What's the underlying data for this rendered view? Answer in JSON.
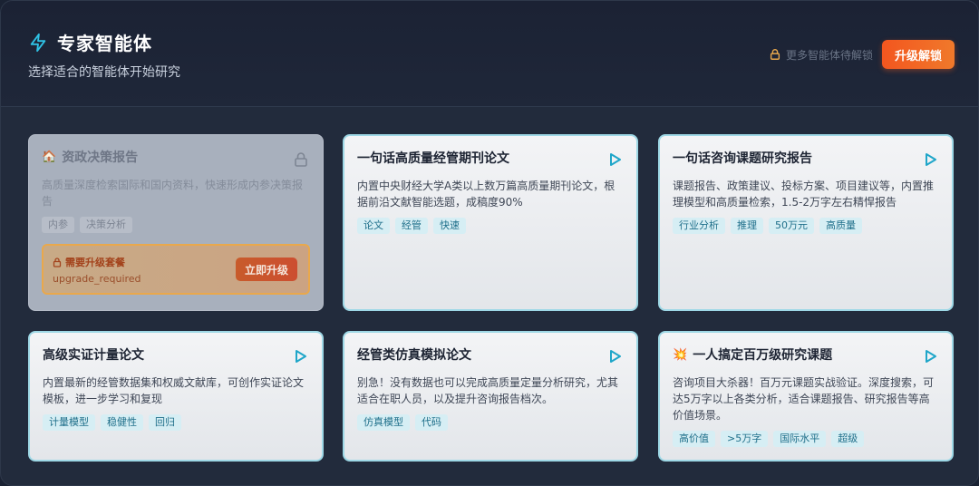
{
  "header": {
    "title": "专家智能体",
    "subtitle": "选择适合的智能体开始研究",
    "lock_note": "更多智能体待解锁",
    "upgrade_label": "升级解锁"
  },
  "cards": [
    {
      "title": "资政决策报告",
      "emoji": "🏠",
      "desc": "高质量深度检索国际和国内资料，快速形成内参决策报告",
      "tags": [
        "内参",
        "决策分析"
      ],
      "locked": true,
      "need_upgrade": "需要升级套餐",
      "code": "upgrade_required",
      "upgrade_now": "立即升级"
    },
    {
      "title": "一句话高质量经管期刊论文",
      "desc": "内置中央财经大学A类以上数万篇高质量期刊论文，根据前沿文献智能选题，成稿度90%",
      "tags": [
        "论文",
        "经管",
        "快速"
      ]
    },
    {
      "title": "一句话咨询课题研究报告",
      "desc": "课题报告、政策建议、投标方案、项目建议等，内置推理模型和高质量检索，1.5-2万字左右精悍报告",
      "tags": [
        "行业分析",
        "推理",
        "50万元",
        "高质量"
      ]
    },
    {
      "title": "高级实证计量论文",
      "desc": "内置最新的经管数据集和权威文献库，可创作实证论文模板，进一步学习和复现",
      "tags": [
        "计量模型",
        "稳健性",
        "回归"
      ]
    },
    {
      "title": "经管类仿真模拟论文",
      "desc": "别急！没有数据也可以完成高质量定量分析研究，尤其适合在职人员，以及提升咨询报告档次。",
      "tags": [
        "仿真模型",
        "代码"
      ]
    },
    {
      "title": "一人搞定百万级研究课题",
      "emoji": "💥",
      "desc": "咨询项目大杀器！百万元课题实战验证。深度搜索，可达5万字以上各类分析，适合课题报告、研究报告等高价值场景。",
      "tags": [
        "高价值",
        ">5万字",
        "国际水平",
        "超级"
      ]
    }
  ],
  "colors": {
    "accent_cyan": "#2fc3e6",
    "upgrade_orange": "#f3561f",
    "card_border": "#9ed8e6"
  }
}
